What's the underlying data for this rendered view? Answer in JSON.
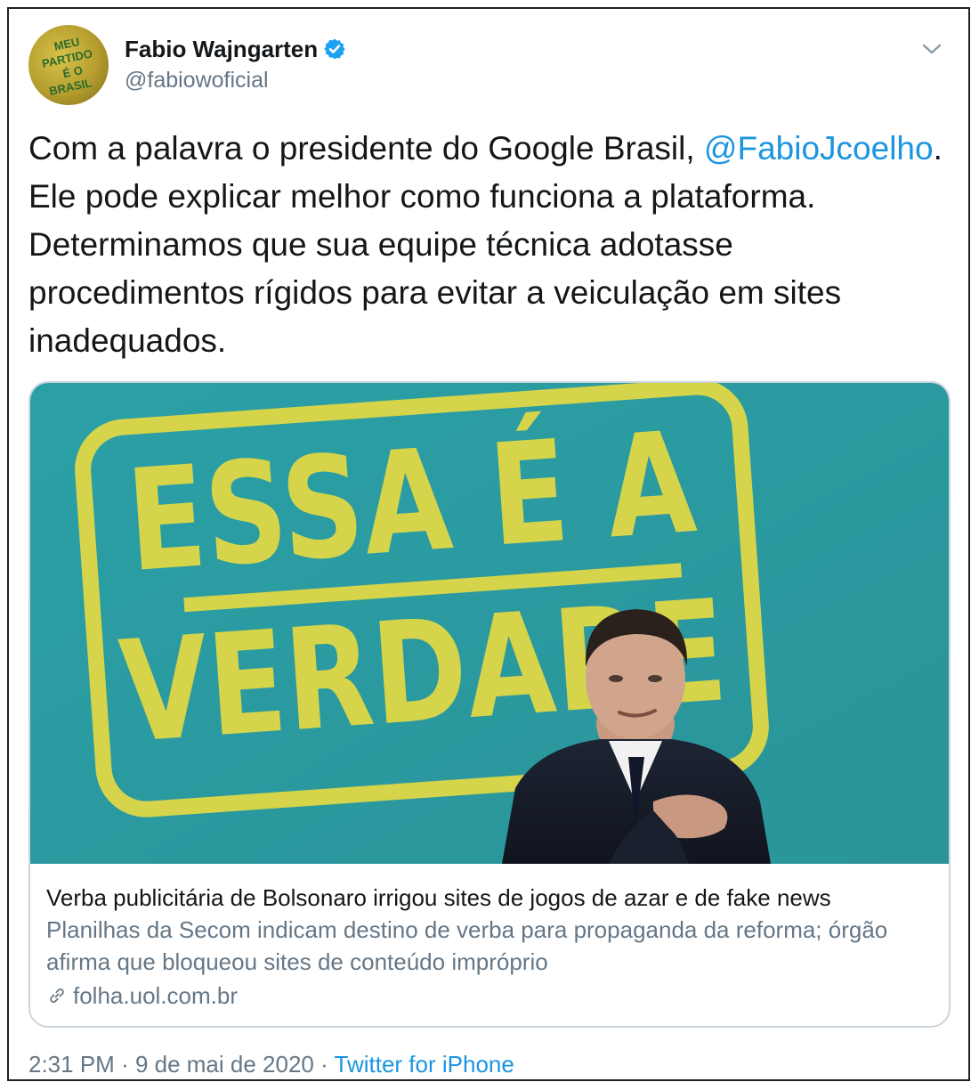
{
  "author": {
    "display_name": "Fabio Wajngarten",
    "handle": "@fabiowoficial",
    "avatar_text": [
      "MEU",
      "PARTIDO",
      "É O",
      "BRASIL"
    ]
  },
  "tweet": {
    "text_before": "Com a palavra o presidente do Google Brasil, ",
    "mention": "@FabioJcoelho",
    "text_after": ". Ele pode explicar melhor como funciona a plataforma. Determinamos que sua equipe técnica adotasse procedimentos rígidos para evitar a veiculação em sites inadequados."
  },
  "card": {
    "image_text_line1": "ESSA É A",
    "image_text_line2": "VERDADE",
    "title": "Verba publicitária de Bolsonaro irrigou sites de jogos de azar e de fake news",
    "description": "Planilhas da Secom indicam destino de verba para propaganda da reforma; órgão afirma que bloqueou sites de conteúdo impróprio",
    "domain": "folha.uol.com.br"
  },
  "meta": {
    "time": "2:31 PM",
    "separator": " · ",
    "date": "9 de mai de 2020",
    "source": "Twitter for iPhone"
  },
  "colors": {
    "link": "#1b95e0",
    "secondary_text": "#657786",
    "verified": "#1da1f2",
    "image_bg": "#2f9ea3",
    "image_yellow": "#d6d44a"
  },
  "icons": {
    "verified": "verified-badge-icon",
    "chevron": "chevron-down-icon",
    "link": "link-icon"
  }
}
